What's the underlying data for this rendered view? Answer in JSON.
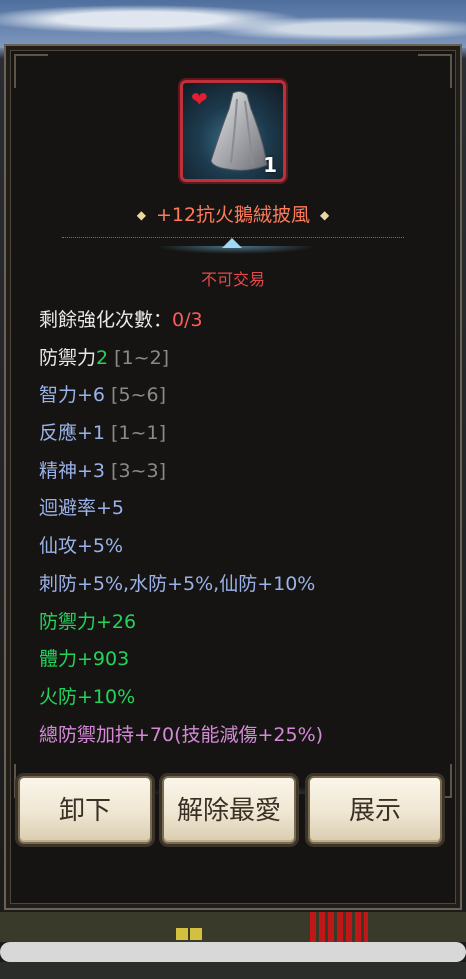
{
  "item": {
    "name": "+12抗火鵝絨披風",
    "quantity": "1",
    "trade_status": "不可交易",
    "icon": "cloak-icon",
    "favorite_icon": "heart-icon"
  },
  "stats": [
    {
      "parts": [
        {
          "text": "剩餘強化次數：",
          "color": "white"
        },
        {
          "text": "0/3",
          "color": "red"
        }
      ]
    },
    {
      "parts": [
        {
          "text": "防禦力",
          "color": "white"
        },
        {
          "text": "2",
          "color": "green"
        },
        {
          "text": " [1~2]",
          "color": "gray"
        }
      ]
    },
    {
      "parts": [
        {
          "text": "智力+6",
          "color": "blue"
        },
        {
          "text": " [5~6]",
          "color": "gray"
        }
      ]
    },
    {
      "parts": [
        {
          "text": "反應+1",
          "color": "blue"
        },
        {
          "text": " [1~1]",
          "color": "gray"
        }
      ]
    },
    {
      "parts": [
        {
          "text": "精神+3",
          "color": "blue"
        },
        {
          "text": " [3~3]",
          "color": "gray"
        }
      ]
    },
    {
      "parts": [
        {
          "text": "迴避率+5",
          "color": "blue"
        }
      ]
    },
    {
      "parts": [
        {
          "text": "仙攻+5%",
          "color": "blue"
        }
      ]
    },
    {
      "parts": [
        {
          "text": "刺防+5%,水防+5%,仙防+10%",
          "color": "blue"
        }
      ]
    },
    {
      "parts": [
        {
          "text": "防禦力+26",
          "color": "green"
        }
      ]
    },
    {
      "parts": [
        {
          "text": "體力+903",
          "color": "green"
        }
      ]
    },
    {
      "parts": [
        {
          "text": "火防+10%",
          "color": "green"
        }
      ]
    },
    {
      "parts": [
        {
          "text": "總防禦加持+70(技能減傷+25%)",
          "color": "purple"
        }
      ]
    }
  ],
  "buttons": {
    "unequip": "卸下",
    "unfavorite": "解除最愛",
    "show": "展示"
  },
  "colors": {
    "white": "#e8e8e8",
    "blue": "#9ab2e8",
    "green": "#22d45a",
    "purple": "#d48ad8",
    "red": "#ff5a5a",
    "gray": "#8a8a8a",
    "title": "#ff7a5a"
  }
}
